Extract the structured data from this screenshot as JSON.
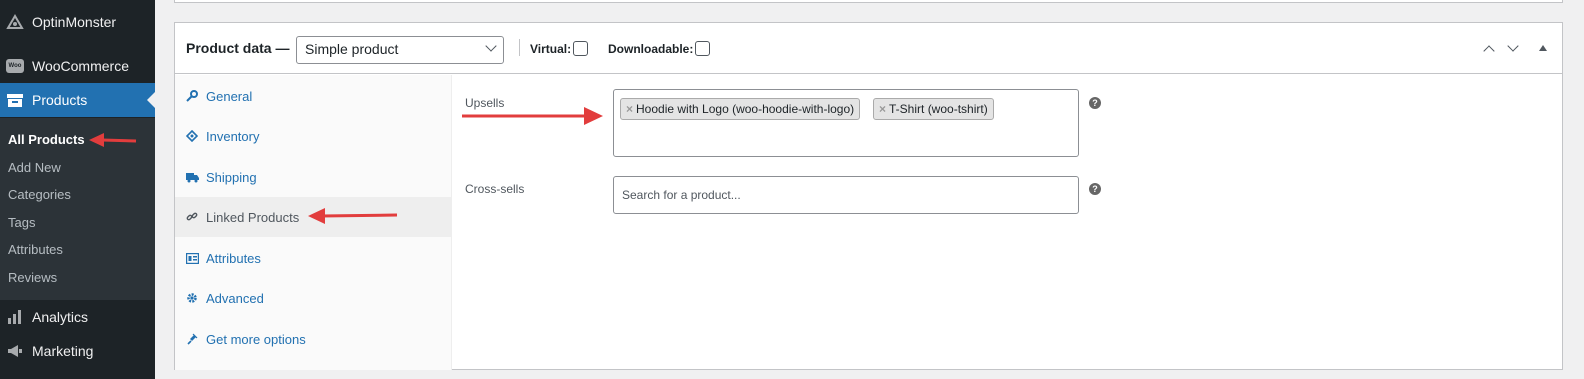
{
  "sidebar": {
    "items": [
      {
        "label": "OptinMonster",
        "icon": "optinmonster-icon"
      },
      {
        "label": "WooCommerce",
        "icon": "woocommerce-icon"
      },
      {
        "label": "Products",
        "icon": "products-icon"
      },
      {
        "label": "Analytics",
        "icon": "analytics-icon"
      },
      {
        "label": "Marketing",
        "icon": "megaphone-icon"
      }
    ],
    "submenu": [
      "All Products",
      "Add New",
      "Categories",
      "Tags",
      "Attributes",
      "Reviews"
    ],
    "current_top": "Products",
    "current_sub": "All Products",
    "woo_badge": "Woo"
  },
  "product_data": {
    "title": "Product data —",
    "type_value": "Simple product",
    "virtual_label": "Virtual:",
    "downloadable_label": "Downloadable:",
    "tabs": [
      {
        "label": "General",
        "icon": "wrench-icon"
      },
      {
        "label": "Inventory",
        "icon": "inventory-icon"
      },
      {
        "label": "Shipping",
        "icon": "truck-icon"
      },
      {
        "label": "Linked Products",
        "icon": "link-icon"
      },
      {
        "label": "Attributes",
        "icon": "attributes-icon"
      },
      {
        "label": "Advanced",
        "icon": "gear-icon"
      },
      {
        "label": "Get more options",
        "icon": "plugin-icon"
      }
    ],
    "active_tab": "Linked Products"
  },
  "linked": {
    "upsells_label": "Upsells",
    "upsells": [
      "Hoodie with Logo (woo-hoodie-with-logo)",
      "T-Shirt (woo-tshirt)"
    ],
    "crosssells_label": "Cross-sells",
    "crosssells_placeholder": "Search for a product...",
    "help_glyph": "?",
    "remove_glyph": "×"
  },
  "colors": {
    "sidebar_bg": "#1d2327",
    "sidebar_current": "#2271b1",
    "annotation_arrow": "#e23d3d",
    "link": "#2271b1"
  }
}
